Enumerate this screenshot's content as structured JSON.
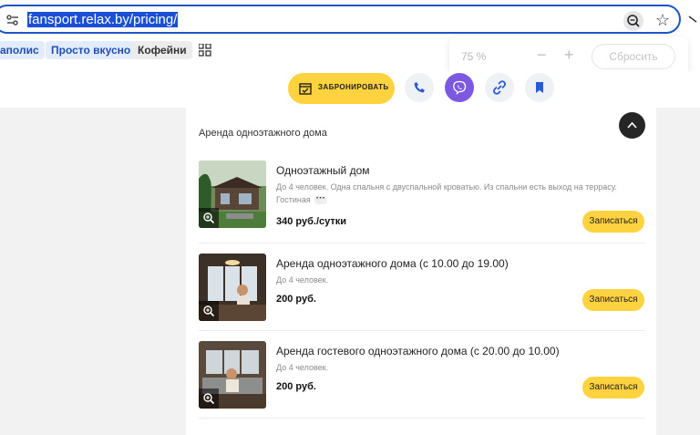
{
  "browser": {
    "url": "fansport.relax.by/pricing/",
    "bookmarks": [
      "аполис",
      "Просто вкусно",
      "Кофейни"
    ],
    "zoom": {
      "value": "75 %",
      "minus": "−",
      "plus": "+",
      "reset": "Сбросить"
    }
  },
  "header": {
    "book_label": "ЗАБРОНИРОВАТЬ",
    "accent": "#ffd23f",
    "viber_color": "#7d58e0"
  },
  "section": {
    "title": "Аренда одноэтажного дома",
    "items": [
      {
        "name": "Одноэтажный дом",
        "description": "До 4 человек. Одна спальня с двуспальной кроватью. Из спальни есть выход на террасу. Гостиная",
        "price": "340 руб./сутки",
        "button": "Записаться"
      },
      {
        "name": "Аренда одноэтажного дома (с 10.00 до 19.00)",
        "description": "До 4 человек.",
        "price": "200 руб.",
        "button": "Записаться"
      },
      {
        "name": "Аренда гостевого одноэтажного дома (с 20.00 до 10.00)",
        "description": "До 4 человек.",
        "price": "200 руб.",
        "button": "Записаться"
      }
    ]
  }
}
